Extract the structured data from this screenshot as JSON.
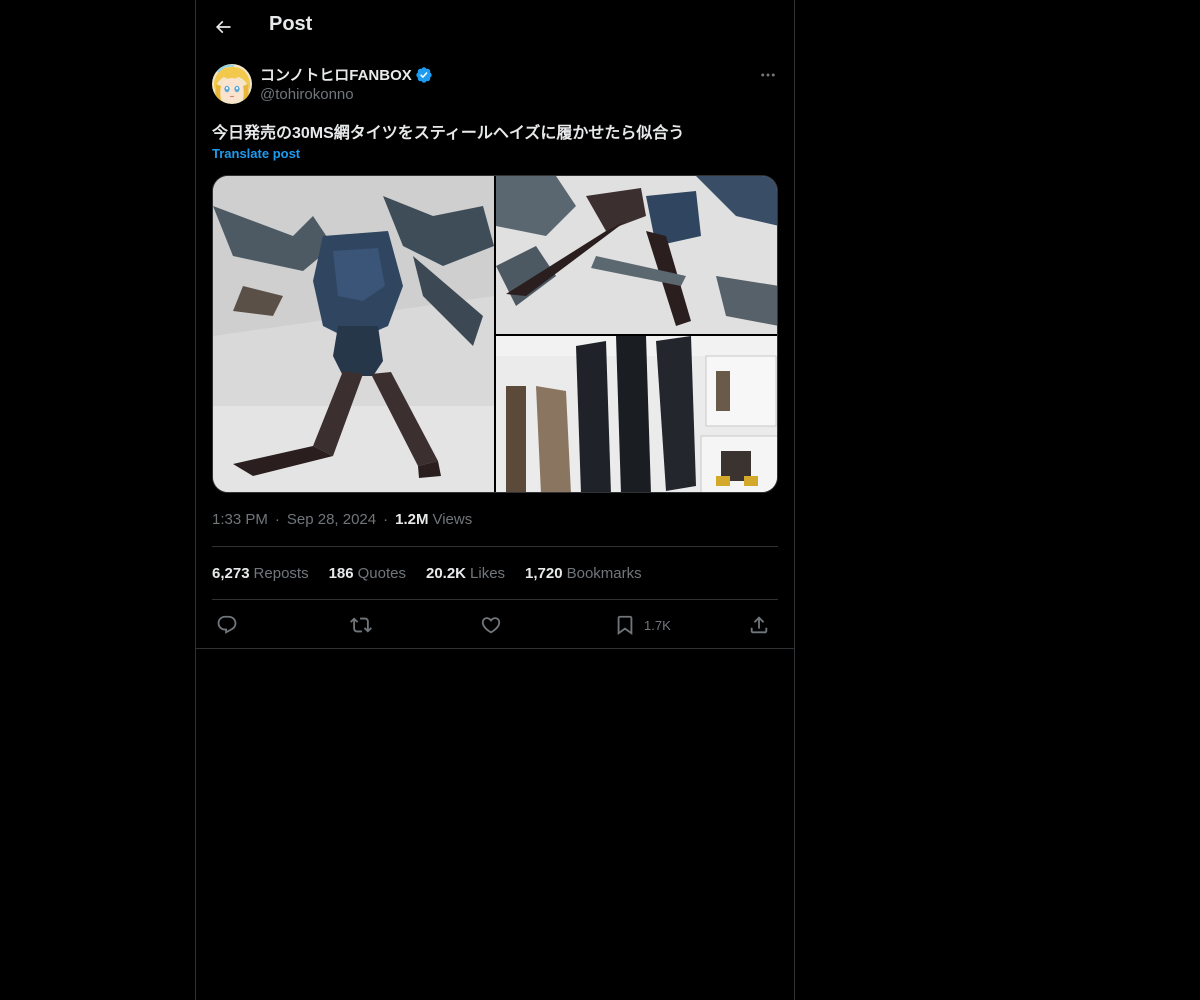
{
  "header": {
    "title": "Post",
    "back_icon": "arrow-left-icon"
  },
  "post": {
    "author": {
      "display_name": "コンノトヒロFANBOX",
      "handle": "@tohirokonno",
      "verified": true
    },
    "text": "今日発売の30MS網タイツをスティールヘイズに履かせたら似合う",
    "translate_label": "Translate post",
    "time": "1:33 PM",
    "date": "Sep 28, 2024",
    "views_count": "1.2M",
    "views_label": "Views",
    "stats": {
      "reposts": {
        "num": "6,273",
        "label": "Reposts"
      },
      "quotes": {
        "num": "186",
        "label": "Quotes"
      },
      "likes": {
        "num": "20.2K",
        "label": "Likes"
      },
      "bookmarks": {
        "num": "1,720",
        "label": "Bookmarks"
      }
    },
    "actions": {
      "reply_icon": "reply-icon",
      "repost_icon": "repost-icon",
      "like_icon": "heart-icon",
      "bookmark_icon": "bookmark-icon",
      "bookmark_count": "1.7K",
      "share_icon": "share-icon"
    },
    "media": [
      {
        "kind": "photo",
        "subject": "figure-full-body"
      },
      {
        "kind": "photo",
        "subject": "figure-legs-fishnet"
      },
      {
        "kind": "photo",
        "subject": "instruction-sheet-decals"
      }
    ]
  },
  "colors": {
    "background": "#000000",
    "text_primary": "#e7e9ea",
    "text_secondary": "#71767b",
    "accent": "#1d9bf0",
    "border": "#2f3336"
  }
}
